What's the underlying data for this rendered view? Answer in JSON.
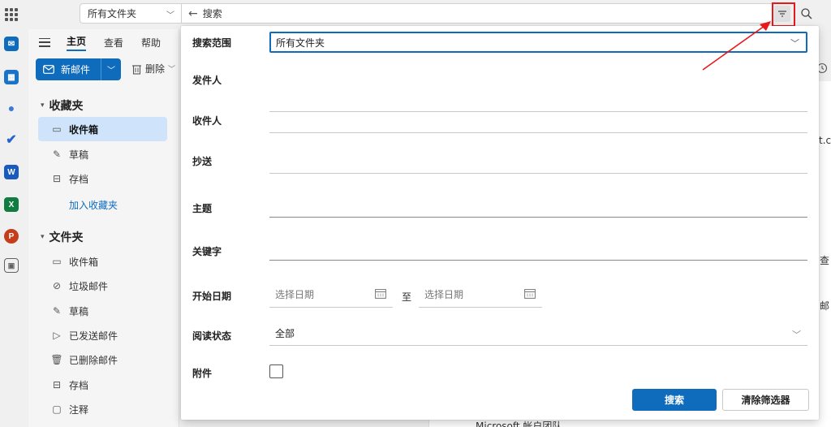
{
  "rail": {
    "apps": [
      {
        "name": "outlook-mail",
        "color": "#0f6cbd",
        "glyph": "✉"
      },
      {
        "name": "calendar",
        "color": "#0f6cbd",
        "glyph": "▦"
      },
      {
        "name": "people",
        "color": "#3a7bd5",
        "glyph": "●"
      },
      {
        "name": "todo",
        "color": "#2564cf",
        "glyph": "✔"
      },
      {
        "name": "word",
        "color": "#185abd",
        "glyph": "W"
      },
      {
        "name": "excel",
        "color": "#107c41",
        "glyph": "X"
      },
      {
        "name": "powerpoint",
        "color": "#c43e1c",
        "glyph": "P"
      },
      {
        "name": "more-apps",
        "color": "#616161",
        "glyph": "▣"
      }
    ]
  },
  "topbar": {
    "scope": "所有文件夹",
    "search_placeholder": "搜索"
  },
  "ribbon": {
    "tabs": [
      "主页",
      "查看",
      "帮助"
    ],
    "new_mail": "新邮件",
    "delete": "删除"
  },
  "favorites": {
    "title": "收藏夹",
    "items": [
      "收件箱",
      "草稿",
      "存档"
    ],
    "add": "加入收藏夹"
  },
  "folders": {
    "title": "文件夹",
    "items": [
      "收件箱",
      "垃圾邮件",
      "草稿",
      "已发送邮件",
      "已删除邮件",
      "存档",
      "注释"
    ]
  },
  "background": {
    "text1": "t.co",
    "text2": "查",
    "text3": "邮",
    "text4": "Microsoft 帐户团队"
  },
  "filter": {
    "scope_label": "搜索范围",
    "scope_value": "所有文件夹",
    "from_label": "发件人",
    "to_label": "收件人",
    "cc_label": "抄送",
    "subject_label": "主题",
    "keyword_label": "关键字",
    "start_date_label": "开始日期",
    "date_placeholder": "选择日期",
    "to_sep": "至",
    "read_label": "阅读状态",
    "read_value": "全部",
    "attachment_label": "附件",
    "search_btn": "搜索",
    "clear_btn": "清除筛选器"
  },
  "colors": {
    "accent": "#0f6cbd",
    "annotation": "#e8191a"
  }
}
